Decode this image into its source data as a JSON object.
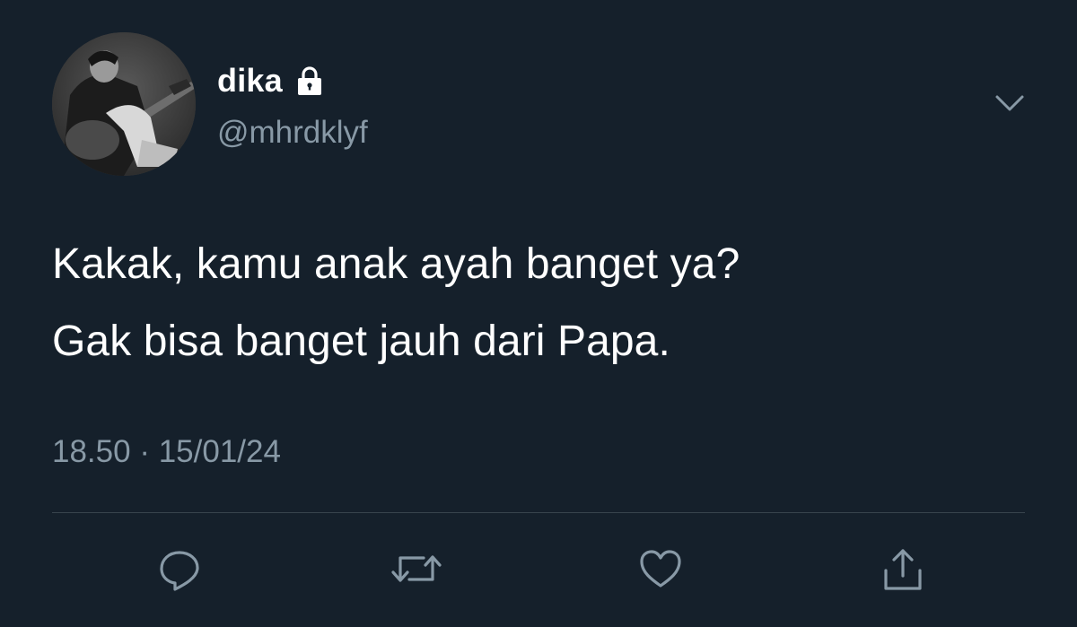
{
  "user": {
    "display_name": "dika",
    "handle": "@mhrdklyf",
    "protected_icon": "lock-icon",
    "avatar_icon": "avatar-photo"
  },
  "menu": {
    "icon": "chevron-down-icon"
  },
  "tweet": {
    "lines": [
      "Kakak, kamu anak ayah banget ya?",
      "Gak bisa banget jauh dari Papa."
    ],
    "time": "18.50",
    "separator": "·",
    "date": "15/01/24"
  },
  "actions": [
    {
      "name": "reply",
      "icon": "reply-icon"
    },
    {
      "name": "retweet",
      "icon": "retweet-icon"
    },
    {
      "name": "like",
      "icon": "heart-icon"
    },
    {
      "name": "share",
      "icon": "share-icon"
    }
  ],
  "colors": {
    "background": "#15202b",
    "primary_text": "#ffffff",
    "secondary_text": "#8899a6",
    "divider": "#38444d"
  }
}
